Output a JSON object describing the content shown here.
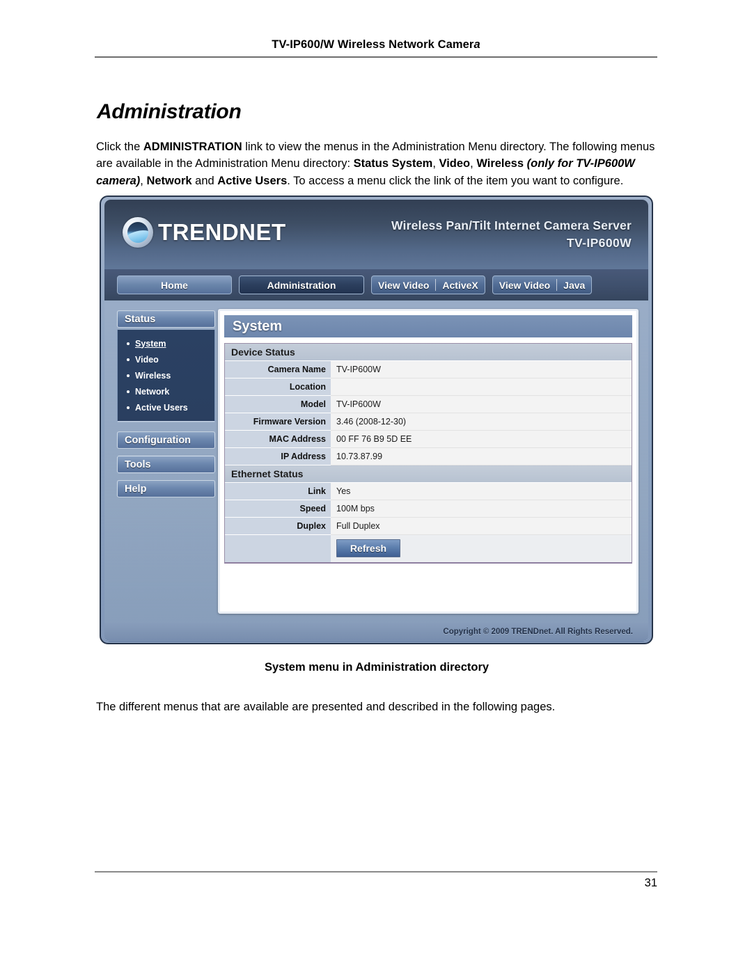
{
  "document": {
    "running_header": "TV-IP600/W Wireless Network Camer",
    "running_header_italic_tail": "a",
    "title": "Administration",
    "intro": {
      "p1_a": "Click the ",
      "p1_admin": "ADMINISTRATION",
      "p1_b": " link to view the menus in the Administration Menu directory. The following menus are available in the Administration Menu directory: ",
      "p1_status_system": "Status System",
      "p1_c": ", ",
      "p1_video": "Video",
      "p1_d": ", ",
      "p1_wireless": "Wireless",
      "p1_only_for": " (only for TV-IP600W camera)",
      "p1_e": ", ",
      "p1_network": "Network",
      "p1_f": " and ",
      "p1_active_users": "Active Users",
      "p1_g": ". To access a menu click the link of the item you want to configure."
    },
    "figure_caption": "System menu in Administration directory",
    "closing": "The different menus that are available are presented and described in the following pages.",
    "page_number": "31"
  },
  "screenshot": {
    "banner": {
      "brand": "TRENDNET",
      "title_line1": "Wireless Pan/Tilt Internet Camera Server",
      "title_line2": "TV-IP600W"
    },
    "nav": {
      "home": "Home",
      "administration": "Administration",
      "view_video_1": "View Video",
      "activex": "ActiveX",
      "view_video_2": "View Video",
      "java": "Java"
    },
    "sidebar": {
      "status_label": "Status",
      "status_items": [
        {
          "label": "System",
          "active": true
        },
        {
          "label": "Video",
          "active": false
        },
        {
          "label": "Wireless",
          "active": false
        },
        {
          "label": "Network",
          "active": false
        },
        {
          "label": "Active Users",
          "active": false
        }
      ],
      "configuration_label": "Configuration",
      "tools_label": "Tools",
      "help_label": "Help"
    },
    "panel": {
      "title": "System",
      "device_status": {
        "heading": "Device Status",
        "rows": [
          {
            "key": "Camera Name",
            "value": "TV-IP600W"
          },
          {
            "key": "Location",
            "value": ""
          },
          {
            "key": "Model",
            "value": "TV-IP600W"
          },
          {
            "key": "Firmware Version",
            "value": "3.46 (2008-12-30)"
          },
          {
            "key": "MAC Address",
            "value": "00 FF 76 B9 5D EE"
          },
          {
            "key": "IP Address",
            "value": "10.73.87.99"
          }
        ]
      },
      "ethernet_status": {
        "heading": "Ethernet Status",
        "rows": [
          {
            "key": "Link",
            "value": "Yes"
          },
          {
            "key": "Speed",
            "value": "100M bps"
          },
          {
            "key": "Duplex",
            "value": "Full Duplex"
          }
        ],
        "refresh_label": "Refresh"
      }
    },
    "copyright": "Copyright © 2009 TRENDnet. All Rights Reserved."
  },
  "colors": {
    "banner_dark": "#2e3c52",
    "panel_title_blue": "#7b93b6",
    "submenu_navy": "#2b4163",
    "label_cell": "#ccd5e2",
    "value_cell": "#f3f3f3",
    "refresh_blue": "#5d7fae"
  }
}
